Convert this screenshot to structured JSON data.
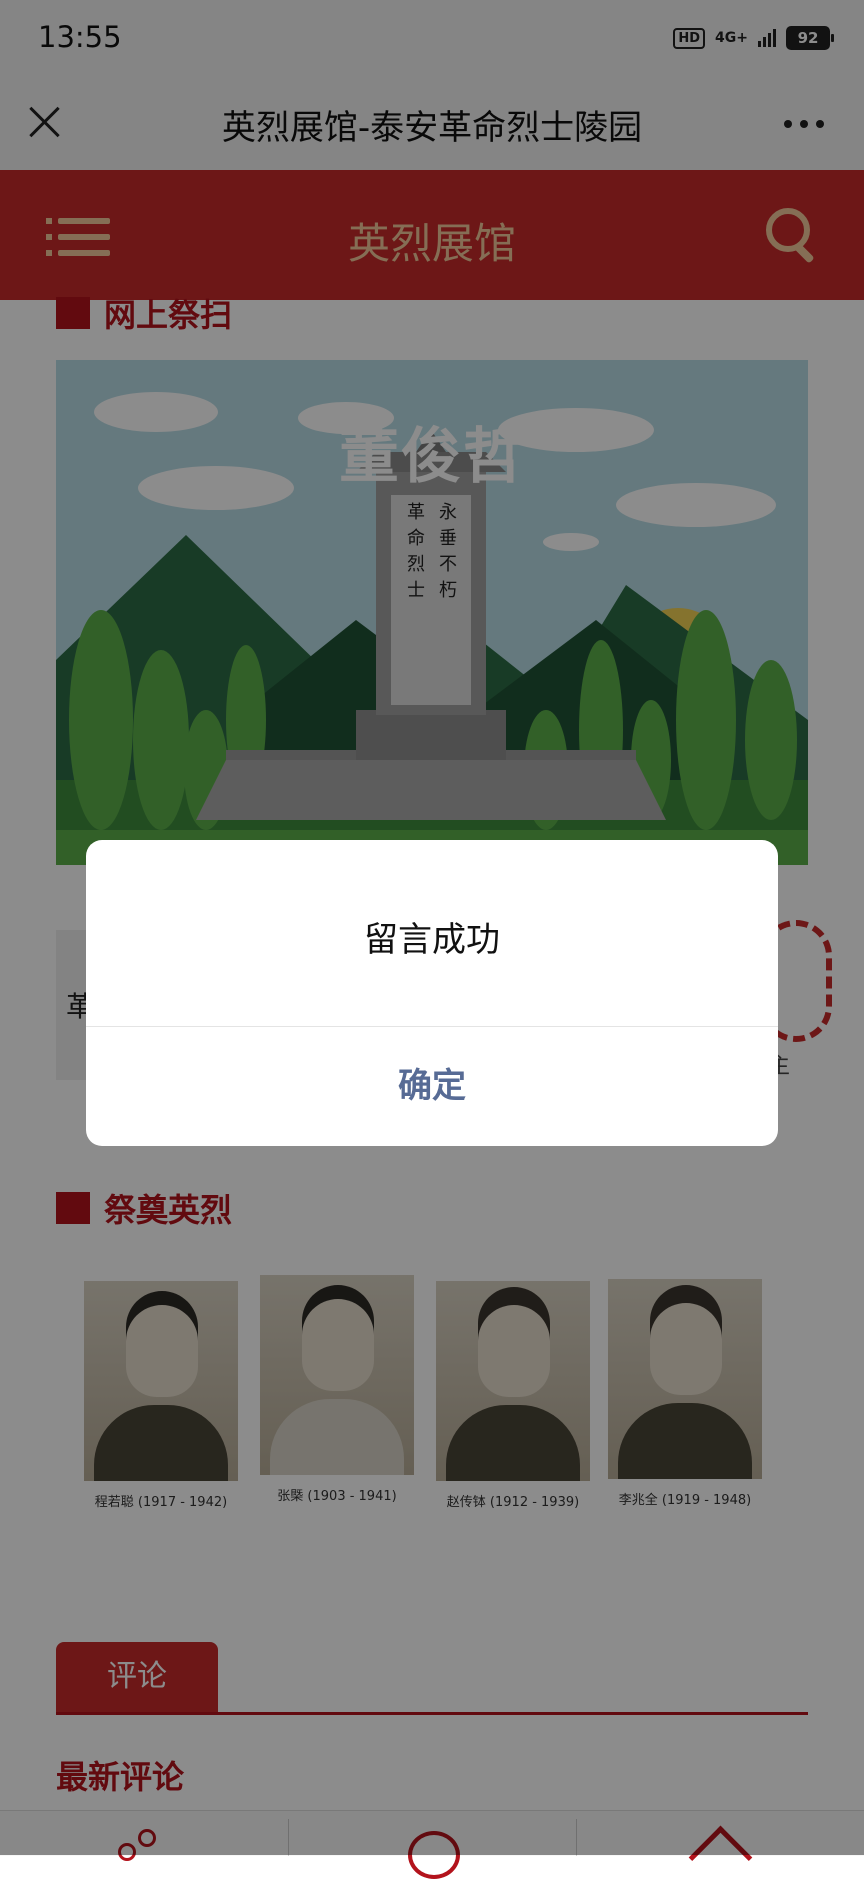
{
  "status_bar": {
    "time": "13:55",
    "hd": "HD",
    "network": "4G+",
    "battery": "92"
  },
  "title_bar": {
    "title": "英烈展馆-泰安革命烈士陵园"
  },
  "header": {
    "title": "英烈展馆"
  },
  "section_online": {
    "title": "网上祭扫"
  },
  "monument": {
    "inscription": [
      "革",
      "命",
      "烈",
      "士",
      "永",
      "垂",
      "不",
      "朽"
    ],
    "name": "董俊哲"
  },
  "card": {
    "left_text": "革",
    "right_text": "主"
  },
  "section_mourn": {
    "title": "祭奠英烈"
  },
  "martyrs": [
    {
      "caption": "程若聪 (1917 - 1942)"
    },
    {
      "caption": "张槩 (1903 - 1941)"
    },
    {
      "caption": "赵传钵 (1912 - 1939)"
    },
    {
      "caption": "李兆全 (1919 - 1948)"
    }
  ],
  "comments": {
    "tab_label": "评论",
    "latest_title": "最新评论"
  },
  "dialog": {
    "message": "留言成功",
    "confirm_label": "确定"
  },
  "colors": {
    "brand_red": "#c62b2b",
    "gold": "#f3c99c",
    "link_blue": "#576b95"
  }
}
